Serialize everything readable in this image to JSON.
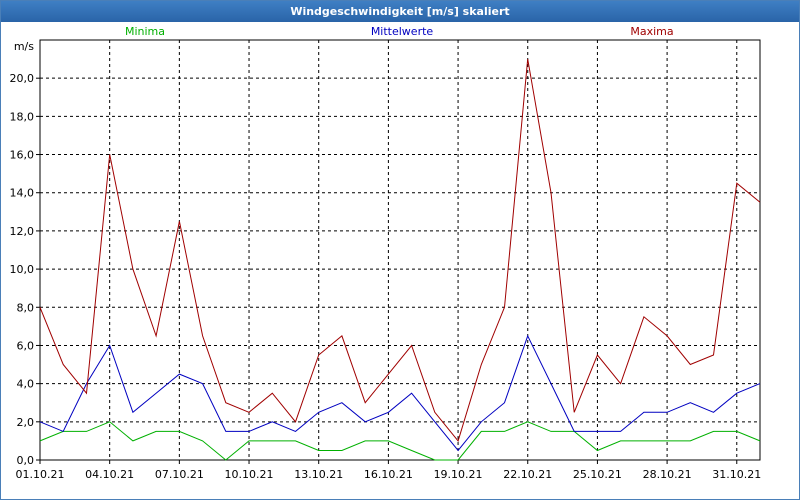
{
  "window": {
    "title": "Windgeschwindigkeit [m/s] skaliert"
  },
  "chart_data": {
    "type": "line",
    "title": "Windgeschwindigkeit [m/s] skaliert",
    "ylabel": "m/s",
    "ylim": [
      0,
      22
    ],
    "xlim": [
      "2021-10-01",
      "2021-11-01"
    ],
    "y_ticks": [
      "0,0",
      "2,0",
      "4,0",
      "6,0",
      "8,0",
      "10,0",
      "12,0",
      "14,0",
      "16,0",
      "18,0",
      "20,0"
    ],
    "x_ticks": [
      "01.10.21",
      "04.10.21",
      "07.10.21",
      "10.10.21",
      "13.10.21",
      "16.10.21",
      "19.10.21",
      "22.10.21",
      "25.10.21",
      "28.10.21",
      "31.10.21"
    ],
    "grid": true,
    "legend_position": "top",
    "x": [
      "2021-10-01",
      "2021-10-02",
      "2021-10-03",
      "2021-10-04",
      "2021-10-05",
      "2021-10-06",
      "2021-10-07",
      "2021-10-08",
      "2021-10-09",
      "2021-10-10",
      "2021-10-11",
      "2021-10-12",
      "2021-10-13",
      "2021-10-14",
      "2021-10-15",
      "2021-10-16",
      "2021-10-17",
      "2021-10-18",
      "2021-10-19",
      "2021-10-20",
      "2021-10-21",
      "2021-10-22",
      "2021-10-23",
      "2021-10-24",
      "2021-10-25",
      "2021-10-26",
      "2021-10-27",
      "2021-10-28",
      "2021-10-29",
      "2021-10-30",
      "2021-10-31",
      "2021-11-01"
    ],
    "series": [
      {
        "name": "Minima",
        "color": "#00b000",
        "values": [
          1.0,
          1.5,
          1.5,
          2.0,
          1.0,
          1.5,
          1.5,
          1.0,
          0.0,
          1.0,
          1.0,
          1.0,
          0.5,
          0.5,
          1.0,
          1.0,
          0.5,
          0.0,
          0.0,
          1.5,
          1.5,
          2.0,
          1.5,
          1.5,
          0.5,
          1.0,
          1.0,
          1.0,
          1.0,
          1.5,
          1.5,
          1.0
        ]
      },
      {
        "name": "Mittelwerte",
        "color": "#0000c0",
        "values": [
          2.0,
          1.5,
          4.0,
          6.0,
          2.5,
          3.5,
          4.5,
          4.0,
          1.5,
          1.5,
          2.0,
          1.5,
          2.5,
          3.0,
          2.0,
          2.5,
          3.5,
          2.0,
          0.5,
          2.0,
          3.0,
          6.5,
          4.0,
          1.5,
          1.5,
          1.5,
          2.5,
          2.5,
          3.0,
          2.5,
          3.5,
          4.0
        ]
      },
      {
        "name": "Maxima",
        "color": "#a00000",
        "values": [
          8.0,
          5.0,
          3.5,
          16.0,
          10.0,
          6.5,
          12.5,
          6.5,
          3.0,
          2.5,
          3.5,
          2.0,
          5.5,
          6.5,
          3.0,
          4.5,
          6.0,
          2.5,
          1.0,
          5.0,
          8.0,
          21.0,
          14.0,
          2.5,
          5.5,
          4.0,
          7.5,
          6.5,
          5.0,
          5.5,
          14.5,
          13.5
        ]
      }
    ]
  }
}
